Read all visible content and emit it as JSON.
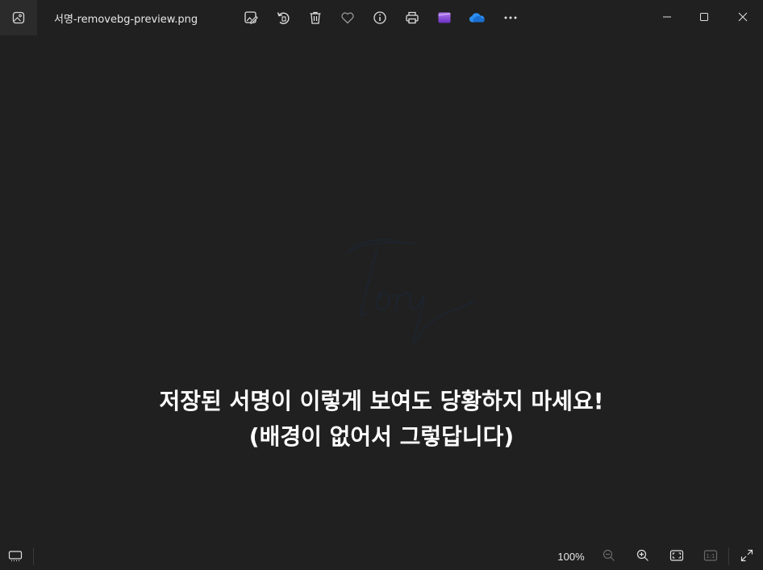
{
  "titlebar": {
    "app_icon": "photos-app-icon",
    "file_name": "서명-removebg-preview.png",
    "toolbar": [
      {
        "name": "edit-image-icon",
        "label": "Edit image"
      },
      {
        "name": "rotate-icon",
        "label": "Rotate"
      },
      {
        "name": "delete-icon",
        "label": "Delete"
      },
      {
        "name": "favorite-heart-icon",
        "label": "Favorite"
      },
      {
        "name": "info-icon",
        "label": "File information"
      },
      {
        "name": "print-icon",
        "label": "Print"
      },
      {
        "name": "clipchamp-icon",
        "label": "Clipchamp"
      },
      {
        "name": "onedrive-cloud-icon",
        "label": "OneDrive"
      },
      {
        "name": "more-options-icon",
        "label": "See more"
      }
    ],
    "window_controls": [
      "minimize-icon",
      "maximize-icon",
      "close-icon"
    ]
  },
  "image": {
    "signature_text": "Tory"
  },
  "caption": {
    "line1": "저장된 서명이 이렇게 보여도 당황하지 마세요!",
    "line2": "(배경이 없어서 그렇답니다)"
  },
  "bottombar": {
    "filmstrip_icon": "filmstrip-icon",
    "zoom_level": "100%",
    "controls": [
      "zoom-out-icon",
      "zoom-in-icon",
      "fit-to-window-icon",
      "actual-size-icon",
      "fullscreen-icon"
    ]
  },
  "colors": {
    "background": "#202020",
    "signature_ink": "#1c2530",
    "accent_onedrive": "#2b8ef0",
    "accent_clipchamp": "#8a4fd8"
  }
}
